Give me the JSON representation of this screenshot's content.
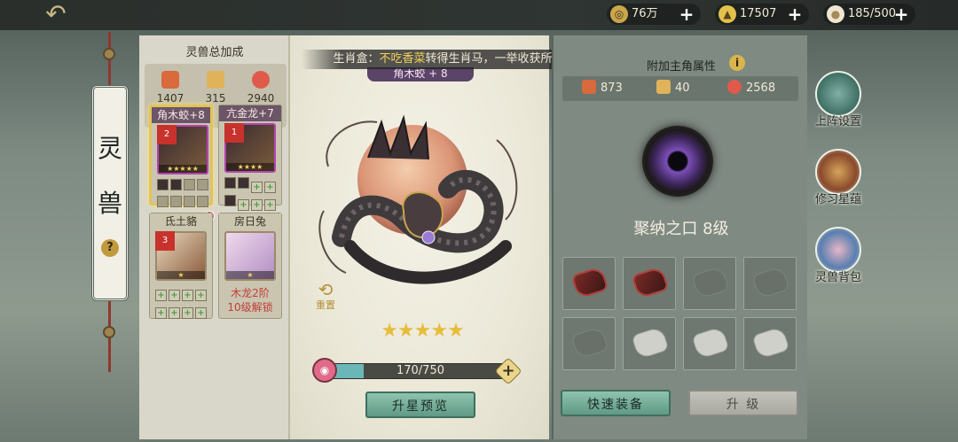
{
  "topbar": {
    "back_icon": "back-arrow-icon",
    "resources": [
      {
        "icon": "coin-icon",
        "value": "76万"
      },
      {
        "icon": "ingot-icon",
        "value": "17507"
      },
      {
        "icon": "bun-icon",
        "value": "185/500"
      }
    ]
  },
  "title": {
    "char1": "灵",
    "char2": "兽",
    "help": "?"
  },
  "left": {
    "title": "灵兽总加成",
    "totals": [
      {
        "icon": "attack-icon",
        "value": "1407"
      },
      {
        "icon": "defense-icon",
        "value": "315"
      },
      {
        "icon": "hp-icon",
        "value": "2940"
      }
    ],
    "cards": [
      {
        "name": "角木蛟+8",
        "badge": "2",
        "stars": "★★★★★"
      },
      {
        "name": "亢金龙+7",
        "badge": "1",
        "stars": "★★★★"
      },
      {
        "name": "氐土貉",
        "badge": "3",
        "stars": "★"
      },
      {
        "name": "房日兔",
        "stars": "★",
        "lock": "木龙2阶\n10级解锁"
      }
    ]
  },
  "center": {
    "tip_prefix": "生肖盒：",
    "tip_highlight": "不吃香菜",
    "tip_suffix": "转得生肖马，一举收获所有大奖！",
    "beast_name": "角木蛟 + 8",
    "reset_label": "重置",
    "stars": "★★★★★",
    "exp": {
      "current": 170,
      "max": 750,
      "text": "170/750"
    },
    "preview_button": "升星预览"
  },
  "right": {
    "title": "附加主角属性",
    "info": "i",
    "attrs": [
      {
        "icon": "attack-icon",
        "value": "873"
      },
      {
        "icon": "defense-icon",
        "value": "40"
      },
      {
        "icon": "hp-icon",
        "value": "2568"
      }
    ],
    "skill_name": "聚纳之口 8级",
    "quick_equip": "快速装备",
    "upgrade": "升 级"
  },
  "side": [
    {
      "label": "上阵设置",
      "icon": "dragon-statue-icon"
    },
    {
      "label": "修习星蕴",
      "icon": "serpent-icon"
    },
    {
      "label": "灵兽背包",
      "icon": "bag-icon"
    }
  ],
  "colors": {
    "accent": "#5f9985",
    "highlight": "#f2d25a",
    "star": "#e7bd3d"
  }
}
